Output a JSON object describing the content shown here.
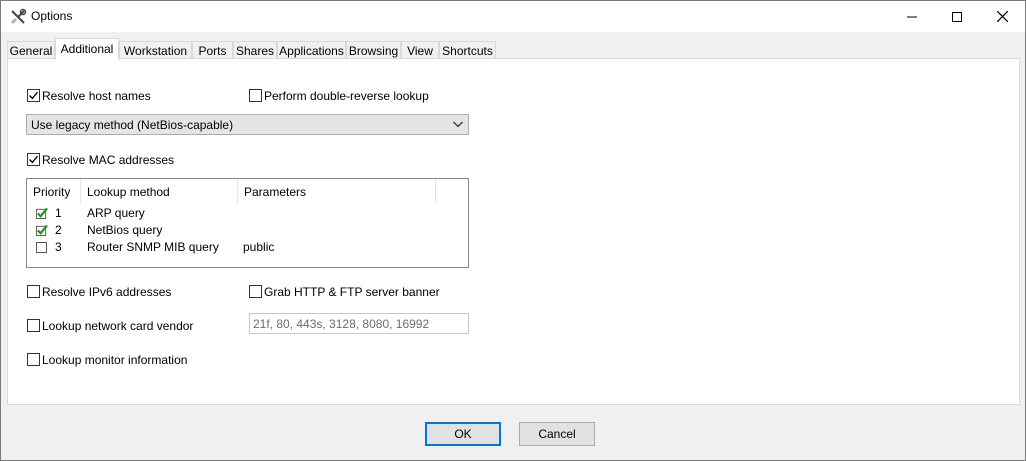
{
  "window": {
    "title": "Options",
    "icons": {
      "app": "tools-icon",
      "minimize": "minimize-icon",
      "maximize": "maximize-icon",
      "close": "close-icon"
    }
  },
  "tabs": [
    {
      "label": "General"
    },
    {
      "label": "Additional",
      "active": true
    },
    {
      "label": "Workstation"
    },
    {
      "label": "Ports"
    },
    {
      "label": "Shares"
    },
    {
      "label": "Applications"
    },
    {
      "label": "Browsing"
    },
    {
      "label": "View"
    },
    {
      "label": "Shortcuts"
    }
  ],
  "options": {
    "resolve_host_names": {
      "label": "Resolve host names",
      "checked": true
    },
    "double_reverse": {
      "label": "Perform double-reverse lookup",
      "checked": false
    },
    "method_select": {
      "value": "Use legacy method (NetBios-capable)"
    },
    "resolve_mac": {
      "label": "Resolve MAC addresses",
      "checked": true
    },
    "resolve_ipv6": {
      "label": "Resolve IPv6 addresses",
      "checked": false
    },
    "grab_banner": {
      "label": "Grab HTTP & FTP server banner",
      "checked": false
    },
    "lookup_vendor": {
      "label": "Lookup network card vendor",
      "checked": false
    },
    "ports_field": {
      "value": "21f, 80, 443s, 3128, 8080, 16992"
    },
    "lookup_monitor": {
      "label": "Lookup monitor information",
      "checked": false
    }
  },
  "mac_table": {
    "columns": [
      "Priority",
      "Lookup method",
      "Parameters"
    ],
    "rows": [
      {
        "checked": true,
        "priority": "1",
        "method": "ARP query",
        "params": ""
      },
      {
        "checked": true,
        "priority": "2",
        "method": "NetBios query",
        "params": ""
      },
      {
        "checked": false,
        "priority": "3",
        "method": "Router SNMP MIB query",
        "params": "public"
      }
    ]
  },
  "buttons": {
    "ok": "OK",
    "cancel": "Cancel"
  },
  "colors": {
    "accent": "#0078d7",
    "check_green": "#1e9a1e"
  }
}
